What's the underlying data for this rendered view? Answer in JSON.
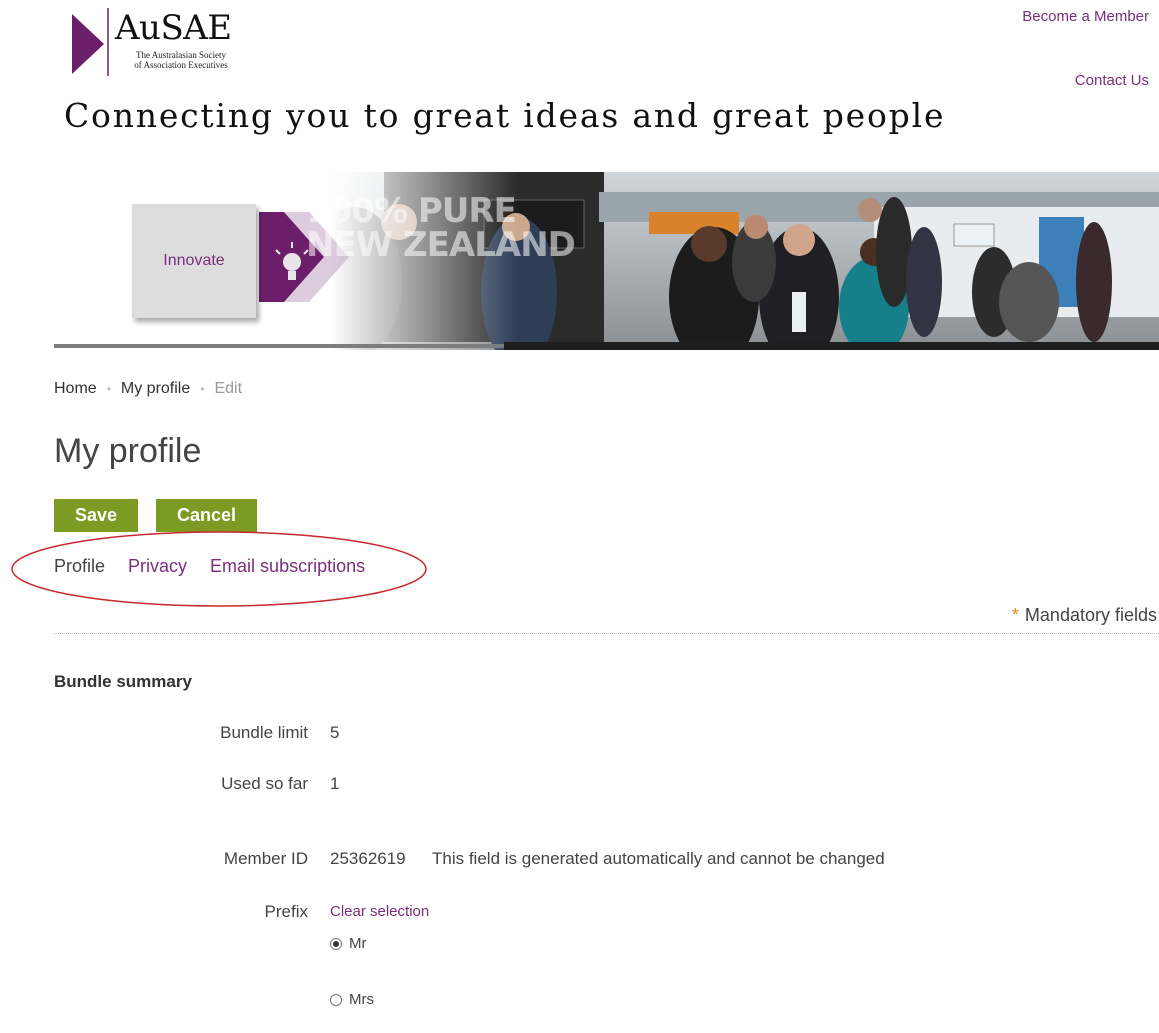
{
  "header": {
    "logo_name": "AuSAE",
    "logo_subtitle_line1": "The Australasian Society",
    "logo_subtitle_line2": "of Association Executives",
    "become_member": "Become a Member",
    "contact_us": "Contact Us",
    "tagline": "Connecting you to great ideas and great people"
  },
  "banner": {
    "card_label": "Innovate",
    "overlay_line1": "100% PURE",
    "overlay_line2": "NEW ZEALAND"
  },
  "breadcrumb": {
    "items": [
      "Home",
      "My profile",
      "Edit"
    ]
  },
  "page": {
    "title": "My profile",
    "save_label": "Save",
    "cancel_label": "Cancel",
    "tabs": [
      "Profile",
      "Privacy",
      "Email subscriptions"
    ],
    "mandatory_star": "*",
    "mandatory_text": "Mandatory fields"
  },
  "bundle": {
    "heading": "Bundle summary",
    "limit_label": "Bundle limit",
    "limit_value": "5",
    "used_label": "Used so far",
    "used_value": "1"
  },
  "member": {
    "id_label": "Member ID",
    "id_value": "25362619",
    "id_note": "This field is generated automatically and cannot be changed",
    "prefix_label": "Prefix",
    "clear_selection": "Clear selection",
    "prefix_options": [
      "Mr",
      "Mrs"
    ],
    "prefix_selected": "Mr"
  },
  "colors": {
    "brand_purple": "#7a2f7d",
    "button_green": "#7c9b22",
    "annotation_red": "#c8282f"
  }
}
